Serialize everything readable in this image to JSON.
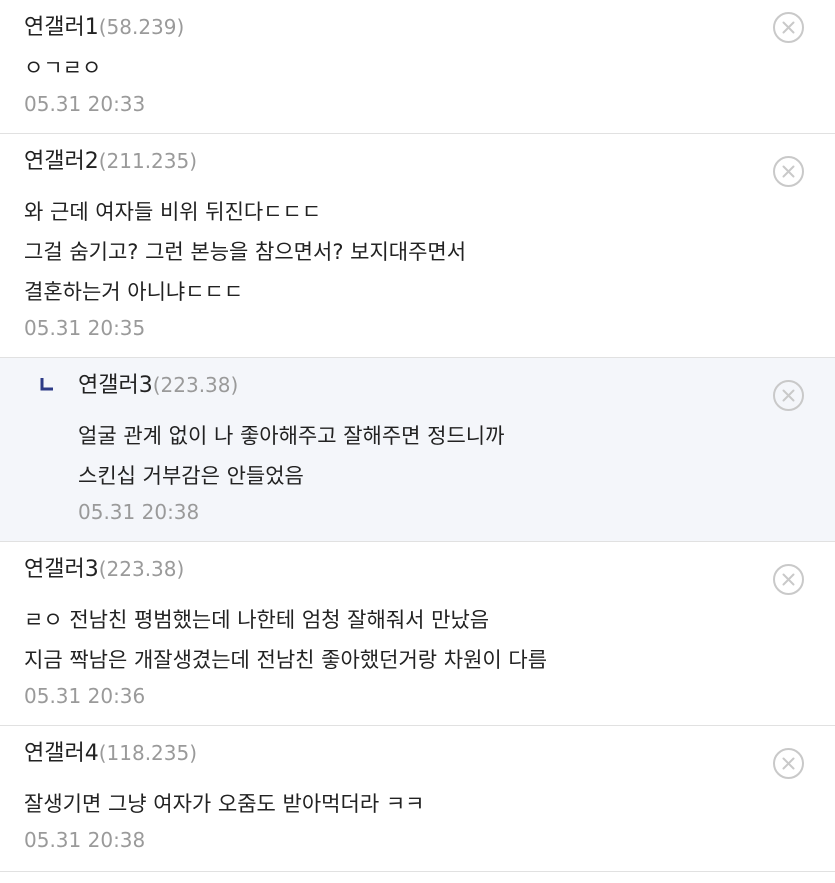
{
  "comments": [
    {
      "nick": "연갤러1",
      "ip": "(58.239)",
      "lines": [
        "ㅇㄱㄹㅇ"
      ],
      "date": "05.31 20:33"
    },
    {
      "nick": "연갤러2",
      "ip": "(211.235)",
      "lines": [
        "와 근데 여자들 비위 뒤진다ㄷㄷㄷ",
        "그걸 숨기고? 그런 본능을 참으면서? 보지대주면서",
        "결혼하는거 아니냐ㄷㄷㄷ"
      ],
      "date": "05.31 20:35"
    },
    {
      "nick": "연갤러3",
      "ip": "(223.38)",
      "lines": [
        "얼굴 관계 없이 나 좋아해주고 잘해주면 정드니까",
        "스킨십 거부감은 안들었음"
      ],
      "date": "05.31 20:38",
      "reply_mark": "ㄴ"
    },
    {
      "nick": "연갤러3",
      "ip": "(223.38)",
      "lines": [
        "ㄹㅇ 전남친 평범했는데 나한테 엄청 잘해줘서 만났음",
        "지금 짝남은 개잘생겼는데 전남친 좋아했던거랑 차원이 다름"
      ],
      "date": "05.31 20:36"
    },
    {
      "nick": "연갤러4",
      "ip": "(118.235)",
      "lines": [
        "잘생기면 그냥 여자가 오줌도 받아먹더라 ㅋㅋ"
      ],
      "date": "05.31 20:38"
    }
  ],
  "icons": {
    "delete": "close-circle-icon",
    "reply": "reply-arrow-icon"
  },
  "colors": {
    "reply_bg": "#f4f6fa",
    "reply_mark": "#2c3a86",
    "meta": "#9a9a9a"
  }
}
